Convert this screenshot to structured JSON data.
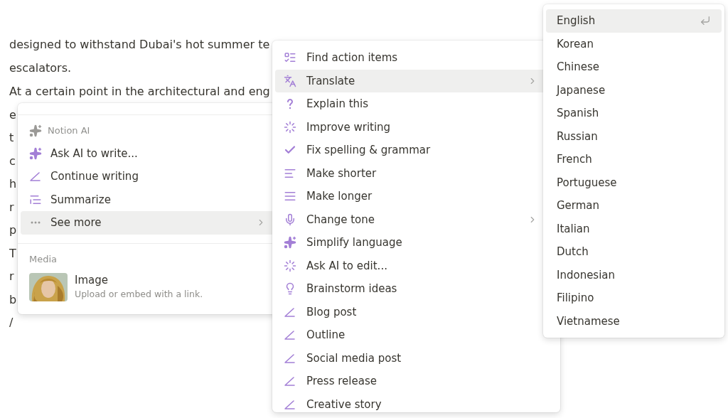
{
  "document": {
    "lines": [
      "designed to withstand Dubai's hot summer te",
      "escalators.",
      "At a certain point in the architectural and eng"
    ],
    "cut_letters": [
      "e",
      "t",
      "c",
      "h",
      "r",
      "p",
      "T",
      "r",
      "b"
    ],
    "slash": "/"
  },
  "block_menu": {
    "section": "Notion AI",
    "items": [
      {
        "label": "Ask AI to write...",
        "kind": "sparkle",
        "submenu": false,
        "selected": false
      },
      {
        "label": "Continue writing",
        "kind": "pen",
        "submenu": false,
        "selected": false
      },
      {
        "label": "Summarize",
        "kind": "quote",
        "submenu": false,
        "selected": false
      },
      {
        "label": "See more",
        "kind": "dots",
        "submenu": true,
        "selected": true
      }
    ],
    "media_section": "Media",
    "media_items": [
      {
        "title": "Image",
        "description": "Upload or embed with a link.",
        "kind": "picture"
      }
    ]
  },
  "ai_menu": {
    "items": [
      {
        "label": "Find action items",
        "kind": "checklist",
        "submenu": false,
        "selected": false
      },
      {
        "label": "Translate",
        "kind": "translate",
        "submenu": true,
        "selected": true
      },
      {
        "label": "Explain this",
        "kind": "question",
        "submenu": false,
        "selected": false
      },
      {
        "label": "Improve writing",
        "kind": "burst",
        "submenu": false,
        "selected": false
      },
      {
        "label": "Fix spelling & grammar",
        "kind": "check",
        "submenu": false,
        "selected": false
      },
      {
        "label": "Make shorter",
        "kind": "short",
        "submenu": false,
        "selected": false
      },
      {
        "label": "Make longer",
        "kind": "long",
        "submenu": false,
        "selected": false
      },
      {
        "label": "Change tone",
        "kind": "mic",
        "submenu": true,
        "selected": false
      },
      {
        "label": "Simplify language",
        "kind": "sparkle",
        "submenu": false,
        "selected": false
      },
      {
        "label": "Ask AI to edit...",
        "kind": "burst",
        "submenu": false,
        "selected": false
      },
      {
        "label": "Brainstorm ideas",
        "kind": "bulb",
        "submenu": false,
        "selected": false
      },
      {
        "label": "Blog post",
        "kind": "pen",
        "submenu": false,
        "selected": false
      },
      {
        "label": "Outline",
        "kind": "pen",
        "submenu": false,
        "selected": false
      },
      {
        "label": "Social media post",
        "kind": "pen",
        "submenu": false,
        "selected": false
      },
      {
        "label": "Press release",
        "kind": "pen",
        "submenu": false,
        "selected": false
      },
      {
        "label": "Creative story",
        "kind": "pen",
        "submenu": false,
        "selected": false
      }
    ]
  },
  "language_menu": {
    "items": [
      {
        "label": "English",
        "selected": true
      },
      {
        "label": "Korean",
        "selected": false
      },
      {
        "label": "Chinese",
        "selected": false
      },
      {
        "label": "Japanese",
        "selected": false
      },
      {
        "label": "Spanish",
        "selected": false
      },
      {
        "label": "Russian",
        "selected": false
      },
      {
        "label": "French",
        "selected": false
      },
      {
        "label": "Portuguese",
        "selected": false
      },
      {
        "label": "German",
        "selected": false
      },
      {
        "label": "Italian",
        "selected": false
      },
      {
        "label": "Dutch",
        "selected": false
      },
      {
        "label": "Indonesian",
        "selected": false
      },
      {
        "label": "Filipino",
        "selected": false
      },
      {
        "label": "Vietnamese",
        "selected": false
      }
    ]
  }
}
